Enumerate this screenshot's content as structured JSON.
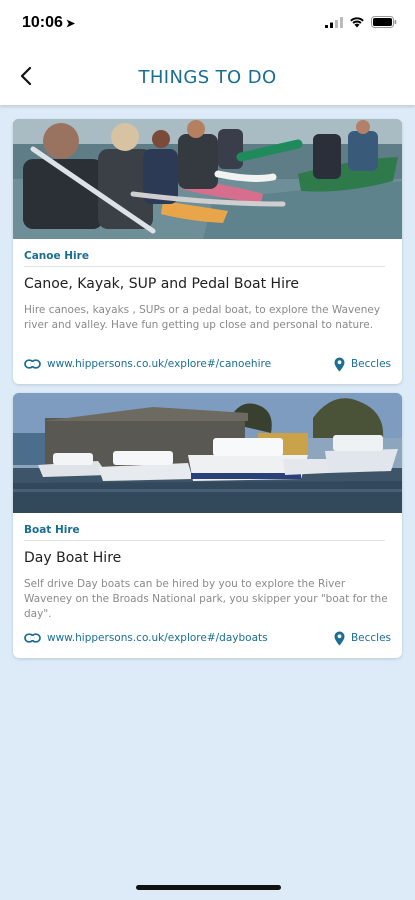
{
  "status_bar": {
    "time": "10:06"
  },
  "header": {
    "title": "THINGS TO DO"
  },
  "cards": [
    {
      "category": "Canoe Hire",
      "title": "Canoe, Kayak, SUP and Pedal Boat Hire",
      "description": "Hire canoes, kayaks , SUPs or a pedal boat,  to explore the Waveney river and valley. Have fun getting up close and personal to nature.",
      "link": "www.hippersons.co.uk/explore#/canoehire",
      "location": "Beccles"
    },
    {
      "category": "Boat Hire",
      "title": "Day Boat Hire",
      "description": "Self drive Day boats can be hired by you to explore the River Waveney on the Broads National park, you skipper your \"boat for the day\".",
      "link": "www.hippersons.co.uk/explore#/dayboats",
      "location": "Beccles"
    }
  ],
  "colors": {
    "accent": "#1a6e93",
    "background": "#dcebf7",
    "card": "#ffffff"
  },
  "icons": [
    "navigation-arrow-icon",
    "signal-icon",
    "wifi-icon",
    "battery-icon",
    "back-chevron-icon",
    "link-icon",
    "map-pin-icon"
  ]
}
